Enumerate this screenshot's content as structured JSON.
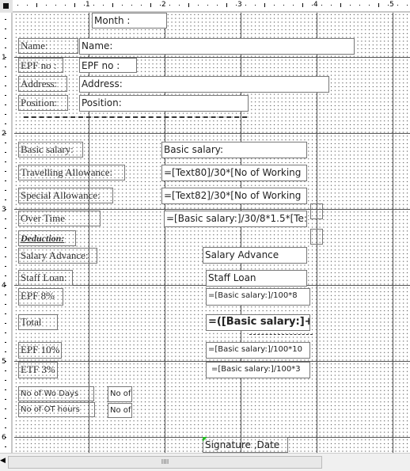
{
  "ruler": {
    "h": [
      "1",
      "2",
      "3",
      "4",
      "5"
    ],
    "v": [
      "1",
      "2",
      "3",
      "4",
      "5",
      "6"
    ]
  },
  "header": {
    "month": "Month :",
    "name_label": "Name:",
    "name_field": "Name:",
    "epf_label": "EPF no :",
    "epf_field": "EPF no :",
    "address_label": "Address:",
    "address_field": "Address:",
    "position_label": "Position:",
    "position_field": "Position:"
  },
  "detail": {
    "basic_label": "Basic salary:",
    "basic_field": "Basic salary:",
    "travel_label": "Travelling Allowance:",
    "travel_field": "=[Text80]/30*[No of Working",
    "special_label": "Special Allowance:",
    "special_field": "=[Text82]/30*[No of Working",
    "ot_label": "Over Time",
    "ot_field": "=[Basic salary:]/30/8*1.5*[Te:",
    "deduction_label": "Deduction:",
    "advance_label": "Salary Advance:",
    "advance_field": "Salary Advance",
    "loan_label": "Staff Loan:",
    "loan_field": "Staff Loan",
    "epf8_label": "EPF 8%",
    "epf8_field": "=[Basic salary:]/100*8",
    "total_label": "Total",
    "total_field": "=([Basic salary:]+[Tı",
    "epf10_label": "EPF 10%",
    "epf10_field": "=[Basic salary:]/100*10",
    "etf_label": "ETF 3%",
    "etf_field": "=[Basic salary:]/100*3",
    "wodays_label": "No of Wo Days",
    "wodays_field": "No of",
    "othours_label": "No of OT hours",
    "othours_field": "No of"
  },
  "footer": {
    "signature": "Signature ,Date"
  },
  "scrollbar": {
    "thumb": "IIII"
  },
  "colors": {
    "selection_handle": "#22bb22"
  }
}
